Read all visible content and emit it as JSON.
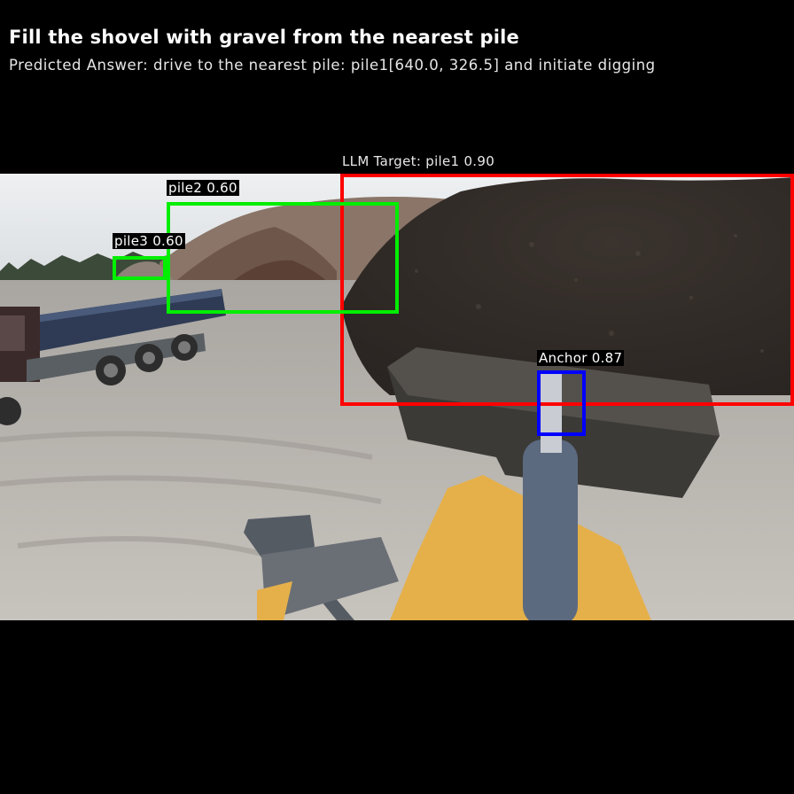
{
  "header": {
    "instruction": "Fill the shovel with gravel from the nearest pile",
    "predicted_answer": "Predicted Answer: drive to the nearest pile: pile1[640.0, 326.5] and initiate digging"
  },
  "scene": {
    "description_icon": "wheel-loader-camera-view"
  },
  "detections": [
    {
      "id": "target",
      "label": "LLM Target: pile1 0.90",
      "color": "#ff0000"
    },
    {
      "id": "pile2",
      "label": "pile2 0.60",
      "color": "#00ee00"
    },
    {
      "id": "pile3",
      "label": "pile3 0.60",
      "color": "#00ee00"
    },
    {
      "id": "anchor",
      "label": "Anchor 0.87",
      "color": "#0000ff"
    }
  ]
}
